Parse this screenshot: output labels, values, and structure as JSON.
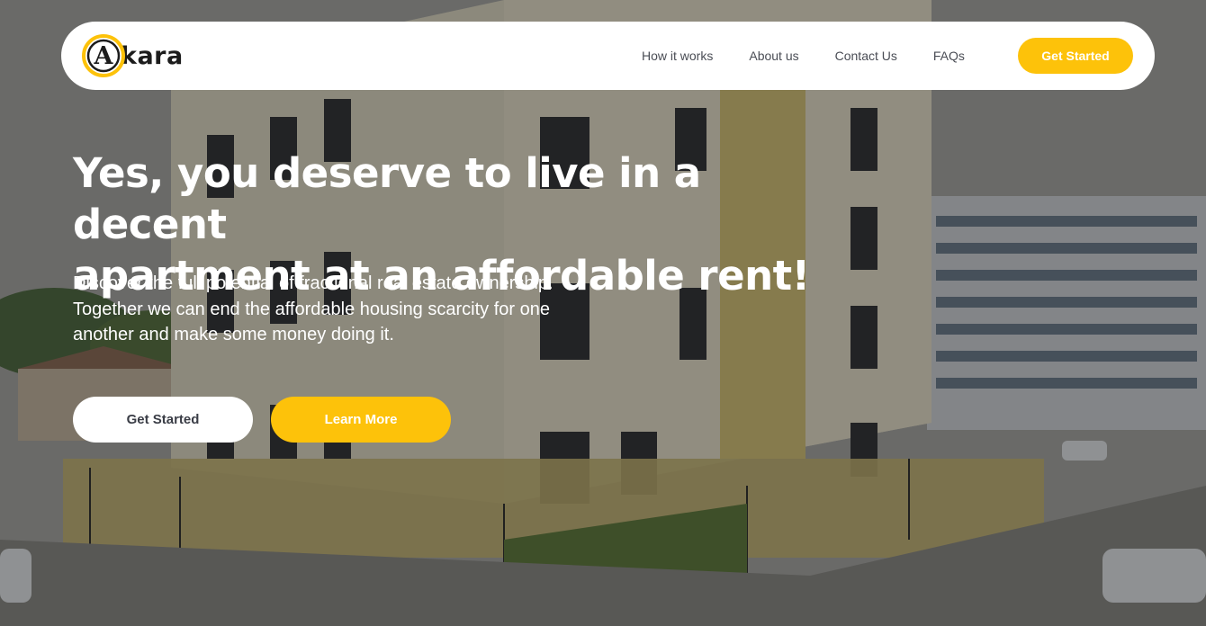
{
  "brand": {
    "logo_letter": "A",
    "logo_text": "kara",
    "accent_color": "#fdc20a"
  },
  "nav": {
    "links": [
      "How it works",
      "About us",
      "Contact Us",
      "FAQs"
    ],
    "cta_label": "Get Started"
  },
  "hero": {
    "headline_line1": "Yes, you deserve to live in a decent",
    "headline_line2": "apartment at an affordable rent!",
    "subtext": "Discover the full potential of fractional real estate ownership. Together we can end the affordable housing scarcity for one another and make some money doing it.",
    "primary_button": "Get Started",
    "secondary_button": "Learn More"
  }
}
